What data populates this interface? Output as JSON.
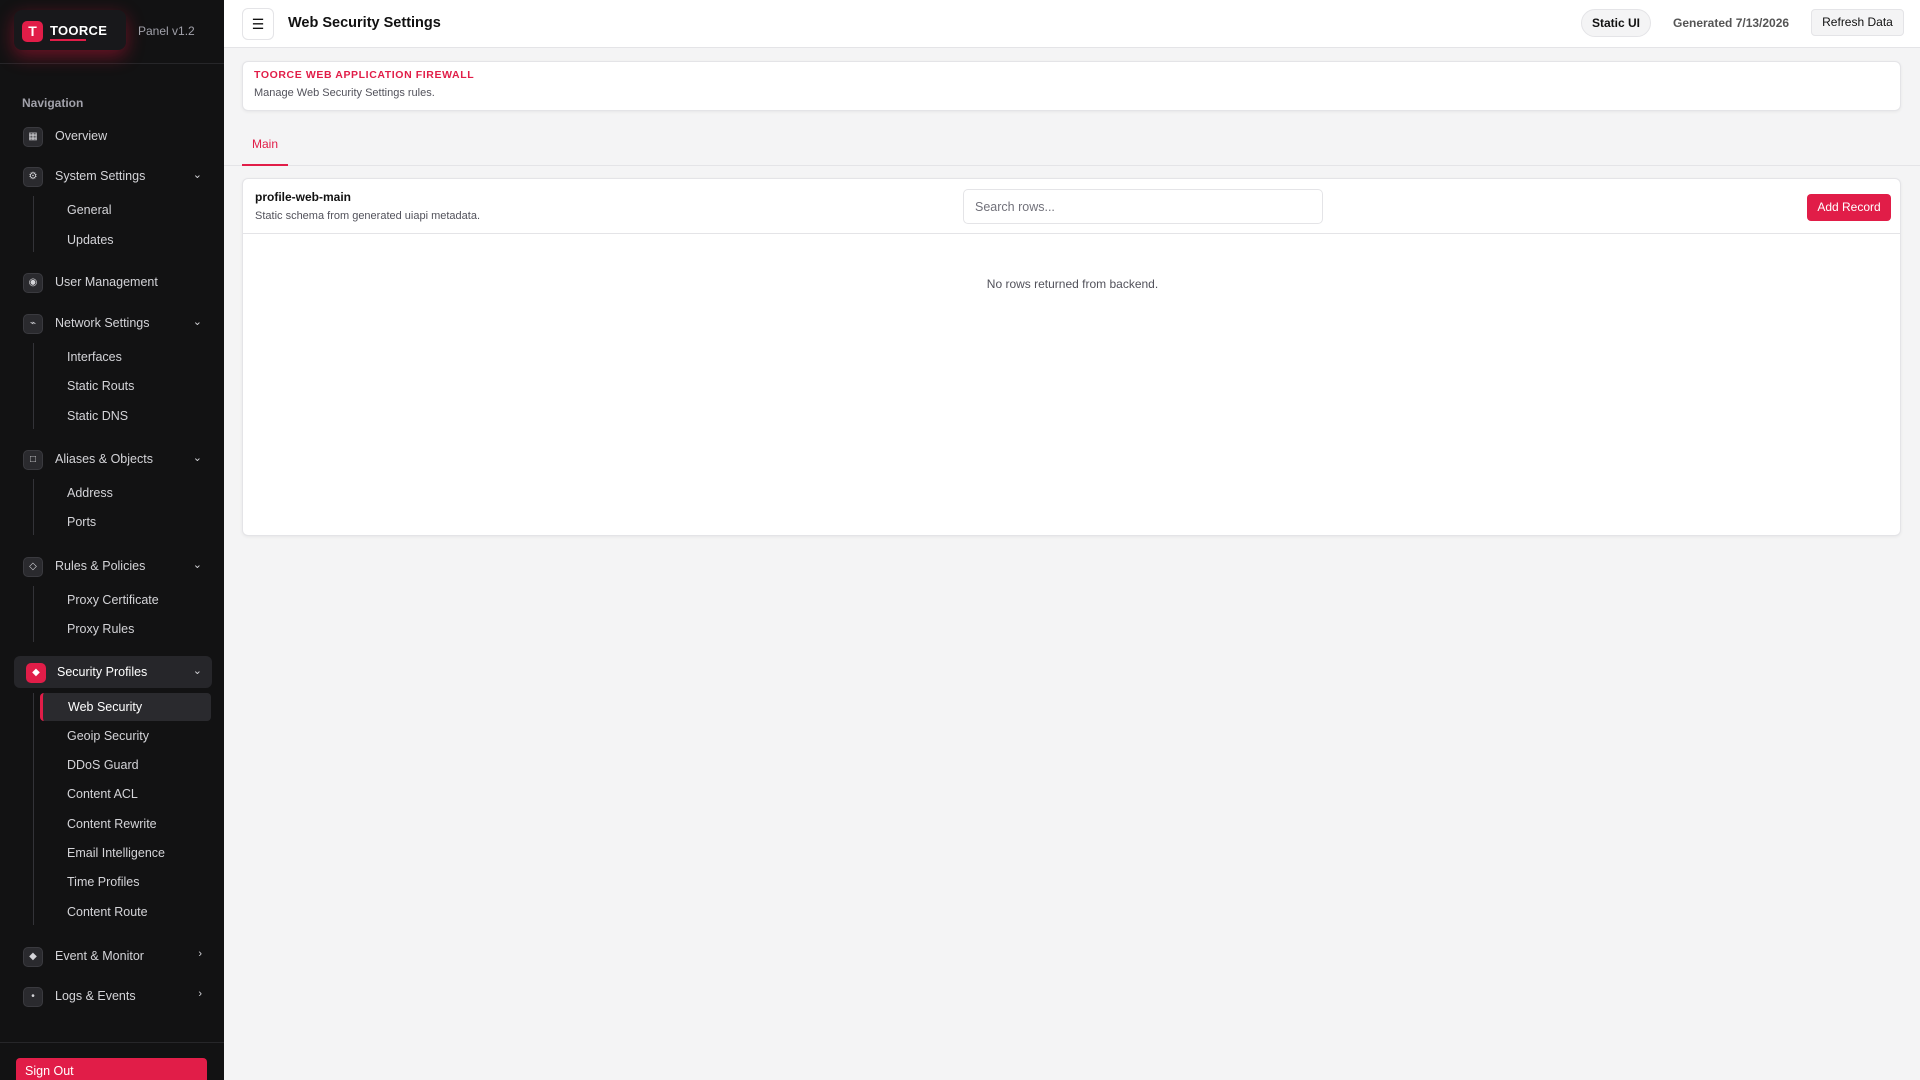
{
  "brand": {
    "logo_letter": "T",
    "name": "TOORCE",
    "version": "Panel v1.2",
    "accent": "#e11d48"
  },
  "sidebar": {
    "heading": "Navigation",
    "groups": [
      {
        "label": "Overview",
        "icon": "grid-icon",
        "icon_glyph": "▦"
      },
      {
        "label": "System Settings",
        "icon": "gear-icon",
        "icon_glyph": "⚙",
        "chevron": "⌄",
        "items": [
          "General",
          "Updates"
        ]
      },
      {
        "label": "User Management",
        "icon": "user-icon",
        "icon_glyph": "◉"
      },
      {
        "label": "Network Settings",
        "icon": "network-icon",
        "icon_glyph": "⌁",
        "chevron": "⌄",
        "items": [
          "Interfaces",
          "Static Routs",
          "Static DNS"
        ]
      },
      {
        "label": "Aliases & Objects",
        "icon": "box-icon",
        "icon_glyph": "□",
        "chevron": "⌄",
        "items": [
          "Address",
          "Ports"
        ]
      },
      {
        "label": "Rules & Policies",
        "icon": "diamond-outline-icon",
        "icon_glyph": "◇",
        "chevron": "⌄",
        "items": [
          "Proxy Certificate",
          "Proxy Rules"
        ]
      },
      {
        "label": "Security Profiles",
        "icon": "shield-diamond-icon",
        "icon_glyph": "◆",
        "chevron": "⌄",
        "active": true,
        "items": [
          "Web Security",
          "Geoip Security",
          "DDoS Guard",
          "Content ACL",
          "Content Rewrite",
          "Email Intelligence",
          "Time Profiles",
          "Content Route"
        ],
        "active_item": "Web Security"
      },
      {
        "label": "Event & Monitor",
        "icon": "monitor-icon",
        "icon_glyph": "◆",
        "chevron": "›"
      },
      {
        "label": "Logs & Events",
        "icon": "dot-icon",
        "icon_glyph": "•",
        "chevron": "›"
      }
    ],
    "sign_out": "Sign Out"
  },
  "header": {
    "menu_glyph": "☰",
    "title": "Web Security Settings",
    "mode_pill": "Static UI",
    "generated": "Generated 7/13/2026",
    "refresh": "Refresh Data"
  },
  "banner": {
    "title": "TOORCE WEB APPLICATION FIREWALL",
    "subtitle": "Manage Web Security Settings rules."
  },
  "tabs": [
    {
      "label": "Main",
      "active": true
    }
  ],
  "table_card": {
    "title": "profile-web-main",
    "subtitle": "Static schema from generated uiapi metadata.",
    "search_placeholder": "Search rows...",
    "add_button": "Add Record",
    "empty_message": "No rows returned from backend."
  }
}
